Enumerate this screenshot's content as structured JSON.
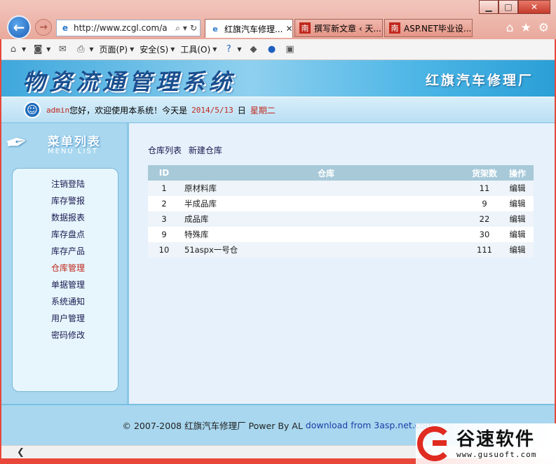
{
  "browser": {
    "address": "http://www.zcgl.com/a",
    "tabs": [
      {
        "label": "红旗汽车修理...",
        "close": "✕"
      },
      {
        "label": "撰写新文章 ‹ 天..."
      },
      {
        "label": "ASP.NET毕业设..."
      }
    ],
    "commands": {
      "page": "页面(P)",
      "safety": "安全(S)",
      "tools": "工具(O)"
    }
  },
  "header": {
    "system_title": "物资流通管理系统",
    "company": "红旗汽车修理厂"
  },
  "welcome": {
    "user": "admin",
    "greeting": "您好，欢迎使用本系统！今天是",
    "date": "2014/5/13",
    "day_label": "日",
    "weekday": "星期二"
  },
  "menu": {
    "title": "菜单列表",
    "subtitle": "MENU LIST",
    "items": [
      {
        "label": "注销登陆"
      },
      {
        "label": "库存警报"
      },
      {
        "label": "数据报表"
      },
      {
        "label": "库存盘点"
      },
      {
        "label": "库存产品"
      },
      {
        "label": "仓库管理"
      },
      {
        "label": "单据管理"
      },
      {
        "label": "系统通知"
      },
      {
        "label": "用户管理"
      },
      {
        "label": "密码修改"
      }
    ]
  },
  "content": {
    "links": {
      "list": "仓库列表",
      "new": "新建仓库"
    },
    "table": {
      "headers": {
        "id": "ID",
        "name": "仓库",
        "shelves": "货架数",
        "action": "操作"
      },
      "rows": [
        {
          "id": "1",
          "name": "原材料库",
          "shelves": "11",
          "action": "编辑"
        },
        {
          "id": "2",
          "name": "半成品库",
          "shelves": "9",
          "action": "编辑"
        },
        {
          "id": "3",
          "name": "成品库",
          "shelves": "22",
          "action": "编辑"
        },
        {
          "id": "9",
          "name": "特殊库",
          "shelves": "30",
          "action": "编辑"
        },
        {
          "id": "10",
          "name": "51aspx一号仓",
          "shelves": "111",
          "action": "编辑"
        }
      ]
    }
  },
  "footer": {
    "copyright": "© 2007-2008 红旗汽车修理厂 Power By AL",
    "download": "download from 3asp.net.com"
  },
  "watermark": {
    "brand": "谷速软件",
    "url": "www.gusuoft.com"
  },
  "colors": {
    "accent_red": "#c0281d",
    "banner_blue": "#3fa8dc",
    "header_row": "#a7c9d8"
  }
}
